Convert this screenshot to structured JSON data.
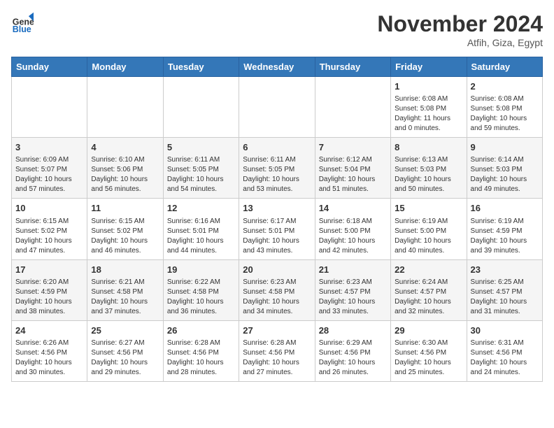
{
  "logo": {
    "general": "General",
    "blue": "Blue"
  },
  "header": {
    "month": "November 2024",
    "location": "Atfih, Giza, Egypt"
  },
  "weekdays": [
    "Sunday",
    "Monday",
    "Tuesday",
    "Wednesday",
    "Thursday",
    "Friday",
    "Saturday"
  ],
  "weeks": [
    [
      {
        "day": "",
        "info": ""
      },
      {
        "day": "",
        "info": ""
      },
      {
        "day": "",
        "info": ""
      },
      {
        "day": "",
        "info": ""
      },
      {
        "day": "",
        "info": ""
      },
      {
        "day": "1",
        "info": "Sunrise: 6:08 AM\nSunset: 5:08 PM\nDaylight: 11 hours\nand 0 minutes."
      },
      {
        "day": "2",
        "info": "Sunrise: 6:08 AM\nSunset: 5:08 PM\nDaylight: 10 hours\nand 59 minutes."
      }
    ],
    [
      {
        "day": "3",
        "info": "Sunrise: 6:09 AM\nSunset: 5:07 PM\nDaylight: 10 hours\nand 57 minutes."
      },
      {
        "day": "4",
        "info": "Sunrise: 6:10 AM\nSunset: 5:06 PM\nDaylight: 10 hours\nand 56 minutes."
      },
      {
        "day": "5",
        "info": "Sunrise: 6:11 AM\nSunset: 5:05 PM\nDaylight: 10 hours\nand 54 minutes."
      },
      {
        "day": "6",
        "info": "Sunrise: 6:11 AM\nSunset: 5:05 PM\nDaylight: 10 hours\nand 53 minutes."
      },
      {
        "day": "7",
        "info": "Sunrise: 6:12 AM\nSunset: 5:04 PM\nDaylight: 10 hours\nand 51 minutes."
      },
      {
        "day": "8",
        "info": "Sunrise: 6:13 AM\nSunset: 5:03 PM\nDaylight: 10 hours\nand 50 minutes."
      },
      {
        "day": "9",
        "info": "Sunrise: 6:14 AM\nSunset: 5:03 PM\nDaylight: 10 hours\nand 49 minutes."
      }
    ],
    [
      {
        "day": "10",
        "info": "Sunrise: 6:15 AM\nSunset: 5:02 PM\nDaylight: 10 hours\nand 47 minutes."
      },
      {
        "day": "11",
        "info": "Sunrise: 6:15 AM\nSunset: 5:02 PM\nDaylight: 10 hours\nand 46 minutes."
      },
      {
        "day": "12",
        "info": "Sunrise: 6:16 AM\nSunset: 5:01 PM\nDaylight: 10 hours\nand 44 minutes."
      },
      {
        "day": "13",
        "info": "Sunrise: 6:17 AM\nSunset: 5:01 PM\nDaylight: 10 hours\nand 43 minutes."
      },
      {
        "day": "14",
        "info": "Sunrise: 6:18 AM\nSunset: 5:00 PM\nDaylight: 10 hours\nand 42 minutes."
      },
      {
        "day": "15",
        "info": "Sunrise: 6:19 AM\nSunset: 5:00 PM\nDaylight: 10 hours\nand 40 minutes."
      },
      {
        "day": "16",
        "info": "Sunrise: 6:19 AM\nSunset: 4:59 PM\nDaylight: 10 hours\nand 39 minutes."
      }
    ],
    [
      {
        "day": "17",
        "info": "Sunrise: 6:20 AM\nSunset: 4:59 PM\nDaylight: 10 hours\nand 38 minutes."
      },
      {
        "day": "18",
        "info": "Sunrise: 6:21 AM\nSunset: 4:58 PM\nDaylight: 10 hours\nand 37 minutes."
      },
      {
        "day": "19",
        "info": "Sunrise: 6:22 AM\nSunset: 4:58 PM\nDaylight: 10 hours\nand 36 minutes."
      },
      {
        "day": "20",
        "info": "Sunrise: 6:23 AM\nSunset: 4:58 PM\nDaylight: 10 hours\nand 34 minutes."
      },
      {
        "day": "21",
        "info": "Sunrise: 6:23 AM\nSunset: 4:57 PM\nDaylight: 10 hours\nand 33 minutes."
      },
      {
        "day": "22",
        "info": "Sunrise: 6:24 AM\nSunset: 4:57 PM\nDaylight: 10 hours\nand 32 minutes."
      },
      {
        "day": "23",
        "info": "Sunrise: 6:25 AM\nSunset: 4:57 PM\nDaylight: 10 hours\nand 31 minutes."
      }
    ],
    [
      {
        "day": "24",
        "info": "Sunrise: 6:26 AM\nSunset: 4:56 PM\nDaylight: 10 hours\nand 30 minutes."
      },
      {
        "day": "25",
        "info": "Sunrise: 6:27 AM\nSunset: 4:56 PM\nDaylight: 10 hours\nand 29 minutes."
      },
      {
        "day": "26",
        "info": "Sunrise: 6:28 AM\nSunset: 4:56 PM\nDaylight: 10 hours\nand 28 minutes."
      },
      {
        "day": "27",
        "info": "Sunrise: 6:28 AM\nSunset: 4:56 PM\nDaylight: 10 hours\nand 27 minutes."
      },
      {
        "day": "28",
        "info": "Sunrise: 6:29 AM\nSunset: 4:56 PM\nDaylight: 10 hours\nand 26 minutes."
      },
      {
        "day": "29",
        "info": "Sunrise: 6:30 AM\nSunset: 4:56 PM\nDaylight: 10 hours\nand 25 minutes."
      },
      {
        "day": "30",
        "info": "Sunrise: 6:31 AM\nSunset: 4:56 PM\nDaylight: 10 hours\nand 24 minutes."
      }
    ]
  ]
}
